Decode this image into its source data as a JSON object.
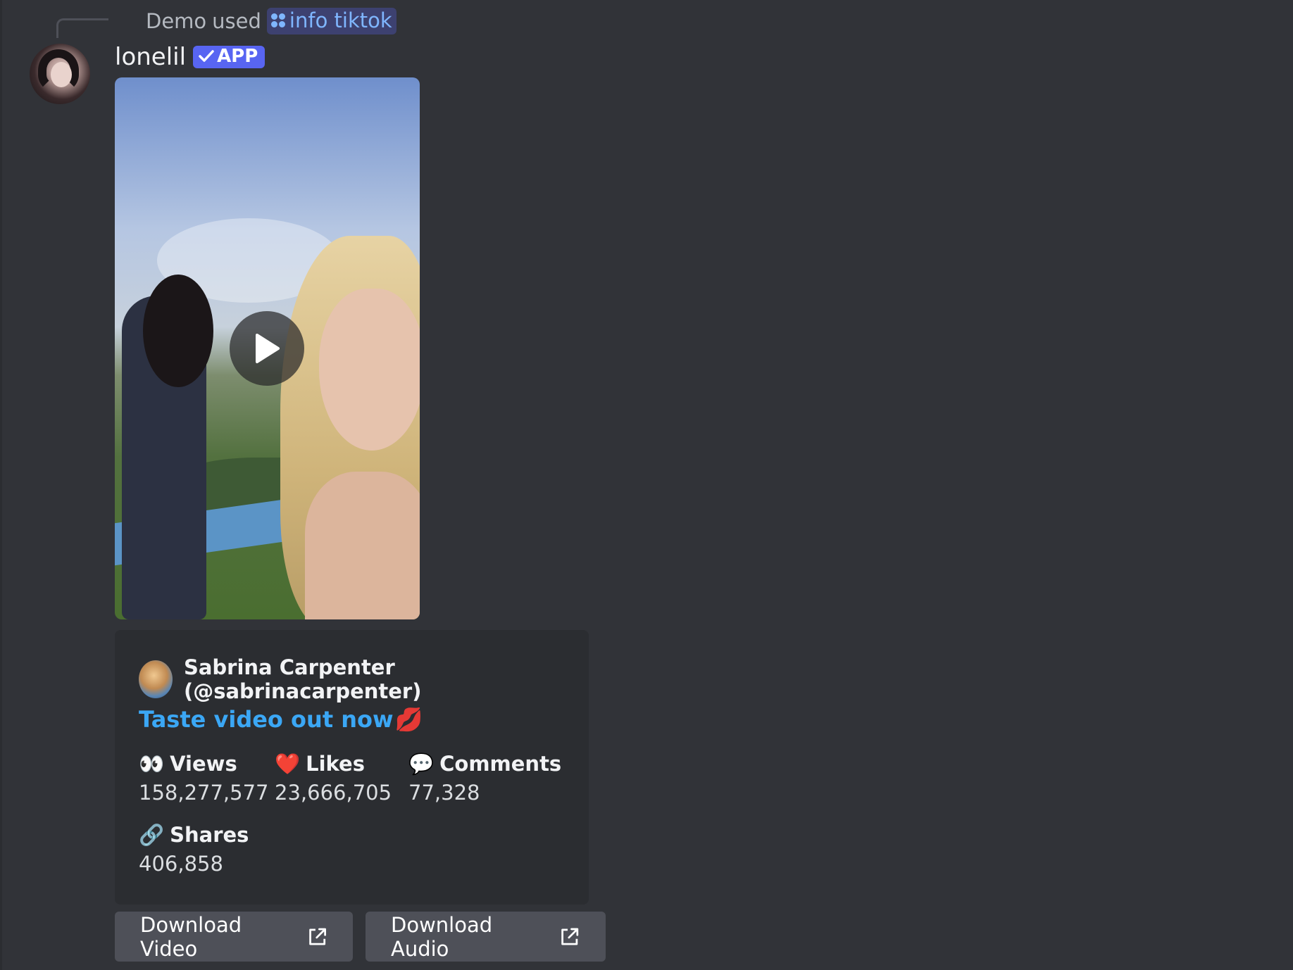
{
  "reply": {
    "user": "Demo",
    "action": "used",
    "command": "info tiktok"
  },
  "message": {
    "username": "lonelil",
    "badge": "APP"
  },
  "embed": {
    "author": "Sabrina Carpenter (@sabrinacarpenter)",
    "title": "Taste video out now",
    "title_emoji": "💋",
    "fields": [
      {
        "emoji": "👀",
        "name": "Views",
        "value": "158,277,577"
      },
      {
        "emoji": "❤️",
        "name": "Likes",
        "value": "23,666,705"
      },
      {
        "emoji": "💬",
        "name": "Comments",
        "value": "77,328"
      },
      {
        "emoji": "🔗",
        "name": "Shares",
        "value": "406,858"
      }
    ]
  },
  "buttons": {
    "download_video": "Download Video",
    "download_audio": "Download Audio"
  },
  "colors": {
    "background": "#313338",
    "embed_background": "#2b2d31",
    "link_blue": "#3ba7f5",
    "app_badge": "#5865f2",
    "button_gray": "#4e5058"
  },
  "icons": {
    "command": "slash-command-icon",
    "checkmark": "checkmark-icon",
    "play": "play-icon",
    "external_link": "external-link-icon"
  }
}
